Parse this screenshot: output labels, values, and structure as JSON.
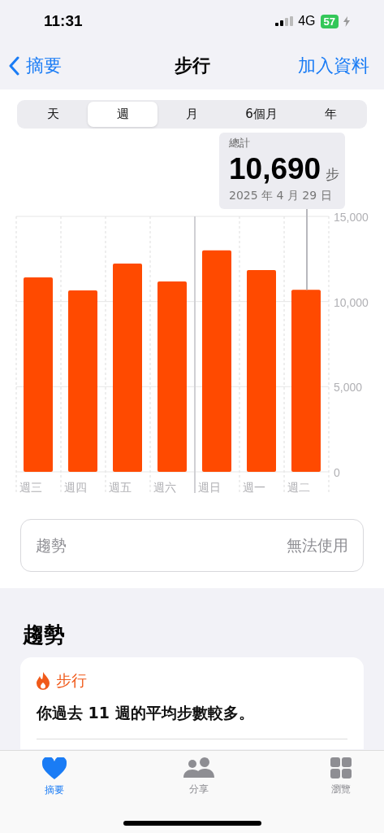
{
  "status_bar": {
    "time": "11:31",
    "network": "4G",
    "battery": "57"
  },
  "nav": {
    "back_label": "摘要",
    "title": "步行",
    "action": "加入資料"
  },
  "segments": [
    {
      "label": "天",
      "selected": false
    },
    {
      "label": "週",
      "selected": true
    },
    {
      "label": "月",
      "selected": false
    },
    {
      "label": "6個月",
      "selected": false
    },
    {
      "label": "年",
      "selected": false
    }
  ],
  "summary": {
    "label": "總計",
    "value": "10,690",
    "unit": "步",
    "date": "2025 年 4 月 29 日"
  },
  "chart_data": {
    "type": "bar",
    "categories": [
      "週三",
      "週四",
      "週五",
      "週六",
      "週日",
      "週一",
      "週二"
    ],
    "series": [
      {
        "color": "#ff4a00",
        "values": [
          11420,
          10650,
          12230,
          11180,
          13000,
          11850,
          10690
        ]
      }
    ],
    "ylim": [
      0,
      15000
    ],
    "yticks": [
      {
        "value": 0,
        "label": "0"
      },
      {
        "value": 5000,
        "label": "5,000"
      },
      {
        "value": 10000,
        "label": "10,000"
      },
      {
        "value": 15000,
        "label": "15,000"
      }
    ]
  },
  "trend_row": {
    "label": "趨勢",
    "value": "無法使用"
  },
  "trends": {
    "heading": "趨勢",
    "card": {
      "title": "步行",
      "text": "你過去 11 週的平均步數較多。"
    }
  },
  "tab_bar": [
    {
      "label": "摘要",
      "kind": "heart",
      "selected": true
    },
    {
      "label": "分享",
      "kind": "people",
      "selected": false
    },
    {
      "label": "瀏覽",
      "kind": "grid",
      "selected": false
    }
  ]
}
